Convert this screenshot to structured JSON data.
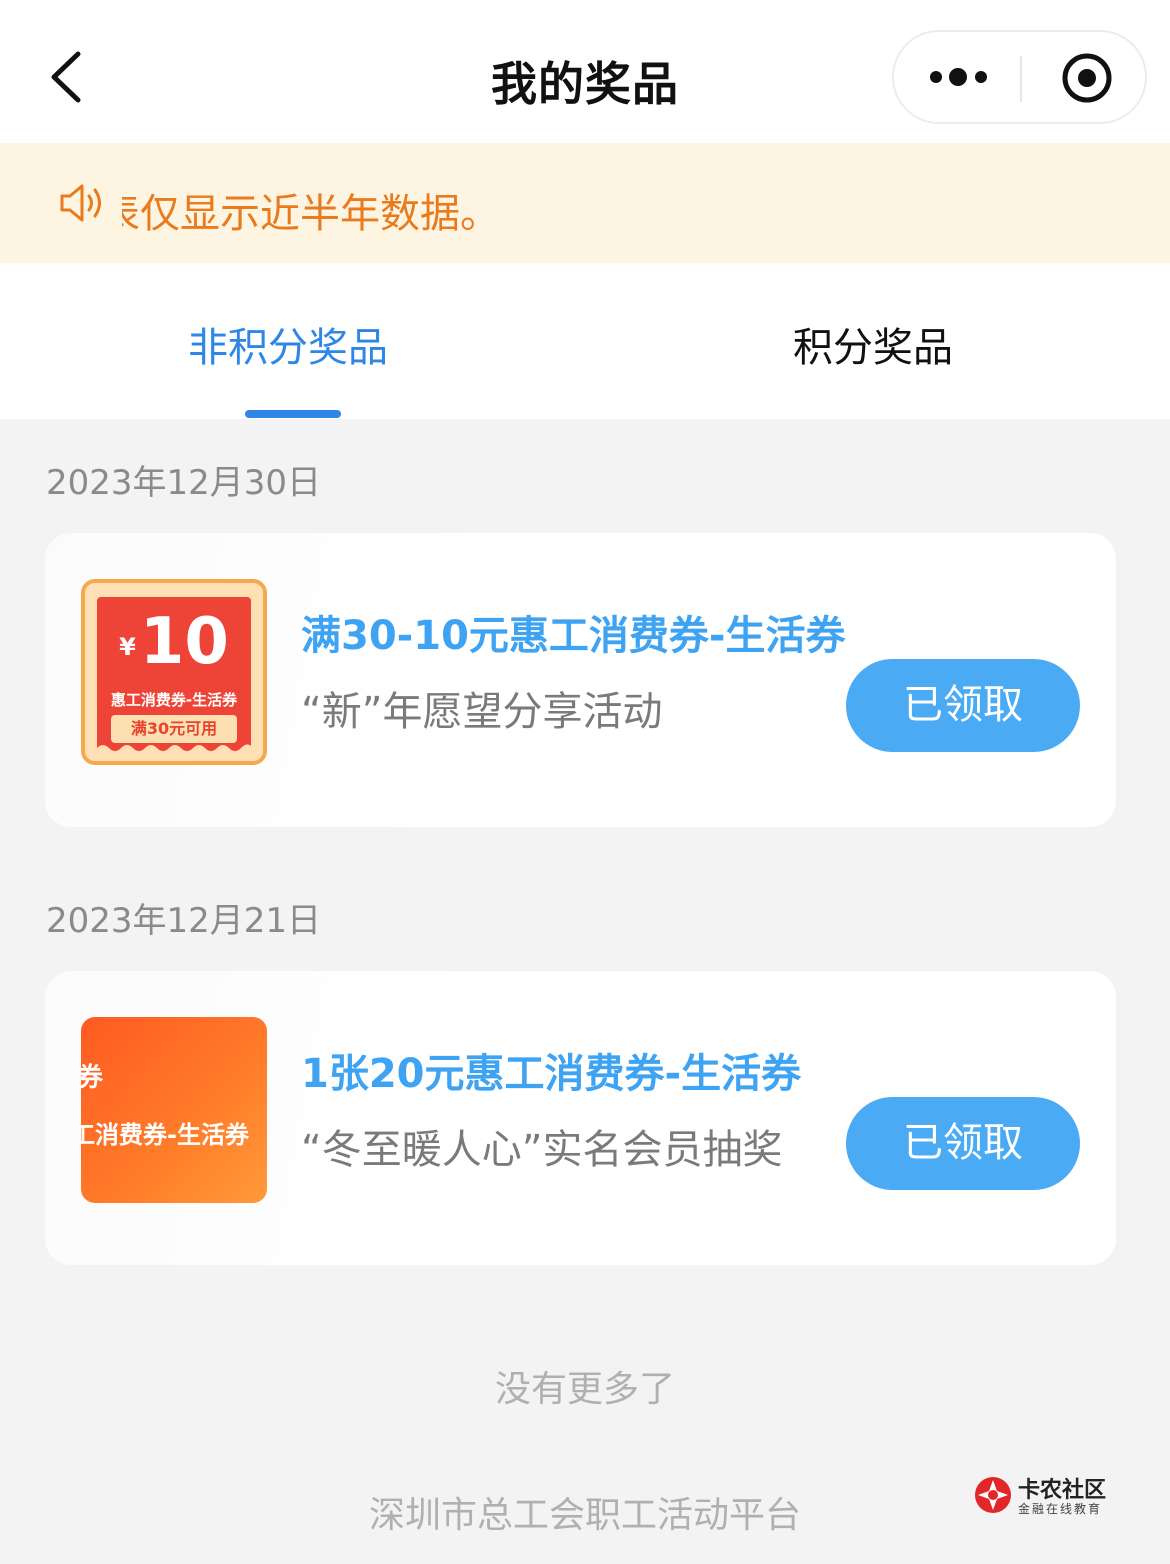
{
  "navbar": {
    "title": "我的奖品",
    "back_icon": "chevron-left-icon",
    "more_icon": "more-dots-icon",
    "close_icon": "target-circle-icon"
  },
  "notice": {
    "icon": "speaker-icon",
    "text": "表仅显示近半年数据。",
    "color": "#e97b1e",
    "background": "#fdf5e1"
  },
  "tabs": [
    {
      "label": "非积分奖品",
      "active": true
    },
    {
      "label": "积分奖品",
      "active": false
    }
  ],
  "accent_color": "#2e86e7",
  "prizes": [
    {
      "date": "2023年12月30日",
      "title": "满30-10元惠工消费券-生活券",
      "desc": "“新”年愿望分享活动",
      "button": "已领取",
      "thumb": {
        "currency": "¥",
        "amount": "10",
        "subtitle": "惠工消费券-生活券",
        "condition": "满30元可用"
      }
    },
    {
      "date": "2023年12月21日",
      "title": "1张20元惠工消费券-生活券",
      "desc": "“冬至暖人心”实名会员抽奖",
      "button": "已领取",
      "thumb": {
        "symbol": "券",
        "label": "工消费券-生活券"
      }
    }
  ],
  "no_more_text": "没有更多了",
  "footer_text": "深圳市总工会职工活动平台",
  "watermark": {
    "title": "卡农社区",
    "subtitle": "金融在线教育"
  }
}
